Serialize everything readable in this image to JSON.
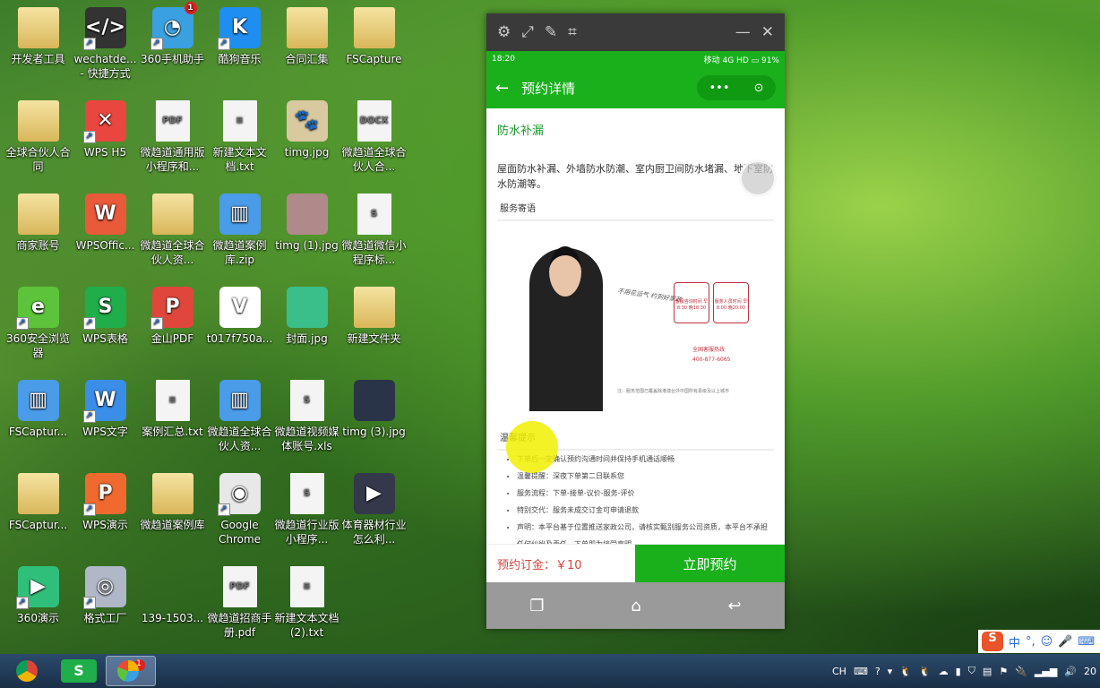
{
  "desktop": {
    "icons": [
      {
        "label": "开发者工具",
        "kind": "folder",
        "color": "#e8c76a"
      },
      {
        "label": "wechatde... - 快捷方式",
        "kind": "app",
        "color": "#333333",
        "glyph": "</>",
        "shortcut": true
      },
      {
        "label": "360手机助手",
        "kind": "app",
        "color": "#3aa0e0",
        "glyph": "◔",
        "shortcut": true,
        "badge": "1"
      },
      {
        "label": "酷狗音乐",
        "kind": "app",
        "color": "#1f8ef1",
        "glyph": "K",
        "shortcut": true
      },
      {
        "label": "合同汇集",
        "kind": "folder"
      },
      {
        "label": "FSCapture",
        "kind": "folder"
      },
      {
        "label": "全球合伙人合同",
        "kind": "folder"
      },
      {
        "label": "WPS H5",
        "kind": "app",
        "color": "#e8463f",
        "glyph": "✕",
        "shortcut": true
      },
      {
        "label": "微趋道通用版小程序和...",
        "kind": "doc",
        "glyph": "PDF"
      },
      {
        "label": "新建文本文档.txt",
        "kind": "doc",
        "glyph": "≡"
      },
      {
        "label": "timg.jpg",
        "kind": "app",
        "color": "#d9c9a0",
        "glyph": "🐾"
      },
      {
        "label": "微趋道全球合伙人合...",
        "kind": "doc",
        "glyph": "DOCX"
      },
      {
        "label": "商家账号",
        "kind": "folder"
      },
      {
        "label": "WPSOffic...",
        "kind": "app",
        "color": "#e85a3a",
        "glyph": "W"
      },
      {
        "label": "微趋道全球合伙人资...",
        "kind": "folder"
      },
      {
        "label": "微趋道案例库.zip",
        "kind": "app",
        "color": "#4a9be8",
        "glyph": "▥"
      },
      {
        "label": "timg (1).jpg",
        "kind": "app",
        "color": "#b08a8a",
        "glyph": ""
      },
      {
        "label": "微趋道微信小程序标...",
        "kind": "doc",
        "glyph": "S"
      },
      {
        "label": "360安全浏览器",
        "kind": "app",
        "color": "#5cc43a",
        "glyph": "e",
        "shortcut": true
      },
      {
        "label": "WPS表格",
        "kind": "app",
        "color": "#1fae4a",
        "glyph": "S",
        "shortcut": true
      },
      {
        "label": "金山PDF",
        "kind": "app",
        "color": "#e0463a",
        "glyph": "P",
        "shortcut": true
      },
      {
        "label": "t017f750a...",
        "kind": "app",
        "color": "#ffffff",
        "glyph": "V"
      },
      {
        "label": "封面.jpg",
        "kind": "app",
        "color": "#3abf8a",
        "glyph": ""
      },
      {
        "label": "新建文件夹",
        "kind": "folder"
      },
      {
        "label": "FSCaptur...",
        "kind": "app",
        "color": "#4a9be8",
        "glyph": "▥"
      },
      {
        "label": "WPS文字",
        "kind": "app",
        "color": "#3a8ee8",
        "glyph": "W",
        "shortcut": true
      },
      {
        "label": "案例汇总.txt",
        "kind": "doc",
        "glyph": "≡"
      },
      {
        "label": "微趋道全球合伙人资...",
        "kind": "app",
        "color": "#4a9be8",
        "glyph": "▥"
      },
      {
        "label": "微趋道视频媒体账号.xls",
        "kind": "doc",
        "glyph": "S"
      },
      {
        "label": "timg (3).jpg",
        "kind": "app",
        "color": "#2a3448",
        "glyph": ""
      },
      {
        "label": "FSCaptur...",
        "kind": "folder"
      },
      {
        "label": "WPS演示",
        "kind": "app",
        "color": "#f06a30",
        "glyph": "P",
        "shortcut": true
      },
      {
        "label": "微趋道案例库",
        "kind": "folder"
      },
      {
        "label": "Google Chrome",
        "kind": "app",
        "color": "#e8e8e8",
        "glyph": "◉",
        "shortcut": true
      },
      {
        "label": "微趋道行业版小程序...",
        "kind": "doc",
        "glyph": "S"
      },
      {
        "label": "体育器材行业怎么利...",
        "kind": "app",
        "color": "#33384a",
        "glyph": "▶"
      },
      {
        "label": "360演示",
        "kind": "app",
        "color": "#2fbf7a",
        "glyph": "▶",
        "shortcut": true
      },
      {
        "label": "格式工厂",
        "kind": "app",
        "color": "#b0b8c8",
        "glyph": "◎",
        "shortcut": true
      },
      {
        "label": "139-1503...",
        "kind": "app",
        "color": "transparent",
        "glyph": ""
      },
      {
        "label": "微趋道招商手册.pdf",
        "kind": "doc",
        "glyph": "PDF"
      },
      {
        "label": "新建文本文档 (2).txt",
        "kind": "doc",
        "glyph": "≡"
      }
    ]
  },
  "window": {
    "toolbar_icons": [
      "gear-icon",
      "fullscreen-icon",
      "pen-icon",
      "crop-icon",
      "minimize-icon",
      "close-icon"
    ],
    "status": {
      "time": "18:20",
      "carrier": "移动 4G HD",
      "battery": "91%"
    },
    "nav": {
      "title": "预约详情",
      "more": "•••",
      "target": "⊙"
    },
    "service_title": "防水补漏",
    "service_desc": "屋面防水补漏、外墙防水防潮、室内厨卫间防水堵漏、地下室防水防潮等。",
    "section_message": "服务寄语",
    "poster": {
      "slogan": "不用花运气 约到好家政",
      "box1": "客服咨询时间 早8:30 晚18:30",
      "box2": "服务人员时间 早8:00 晚20:00",
      "hotline_label": "全国客服热线",
      "hotline": "400-877-6065",
      "note": "注：服务范围已覆盖除港澳台外中国所有县级及以上城市"
    },
    "section_tips": "温馨提示",
    "tips": [
      "下单后一定确认预约沟通时间并保持手机通话顺畅",
      "温馨提醒：深夜下单第二日联系您",
      "服务流程：下单-接单-议价-服务-评价",
      "特别交代：服务未成交订金可申请退款",
      "声明：本平台基于位置推送家政公司，请核实甄别服务公司资质，本平台不承担任何纠纷及责任，下单即为接受声明"
    ],
    "deposit": "预约订金：￥10",
    "book_button": "立即预约",
    "accent": "#19b01c"
  },
  "ime": {
    "logo": "S",
    "mode": "中",
    "punct": "°,"
  },
  "taskbar": {
    "apps": [
      "Google Chrome",
      "WPS表格",
      "360手机助手"
    ],
    "badge": "1",
    "tray_lang": "CH",
    "clock": "20"
  }
}
